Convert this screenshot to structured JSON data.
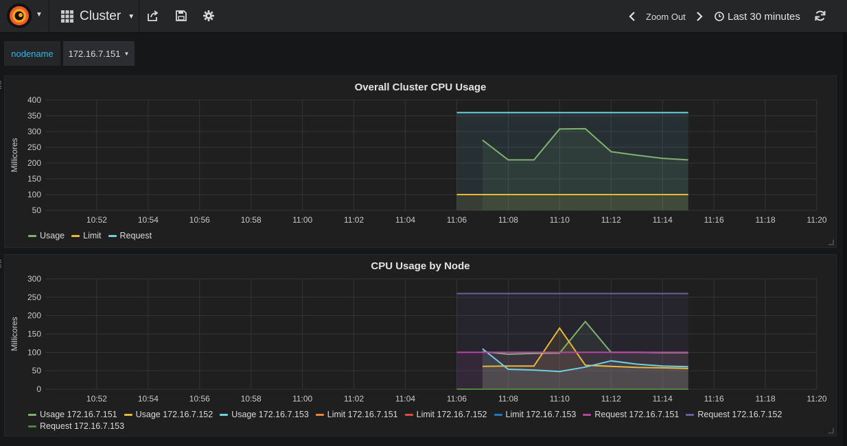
{
  "topbar": {
    "dashboard_title": "Cluster",
    "zoom_out": "Zoom Out",
    "time_range": "Last 30 minutes"
  },
  "variables": {
    "label": "nodename",
    "value": "172.16.7.151"
  },
  "colors": {
    "green": "#7eb26d",
    "yellow": "#eab839",
    "cyan": "#6ed0e0",
    "orange": "#ef843c",
    "red": "#e24d42",
    "blue": "#1f78c1",
    "magenta": "#ba43a9",
    "purple": "#705da0",
    "dark_green": "#508642",
    "accent": "#33b5e5"
  },
  "chart_data": [
    {
      "type": "line",
      "title": "Overall Cluster CPU Usage",
      "ylabel": "Millicores",
      "ylim": [
        50,
        400
      ],
      "yticks": [
        400,
        350,
        300,
        250,
        200,
        150,
        100,
        50
      ],
      "xlim": [
        "10:50",
        "11:20"
      ],
      "xticks": [
        "10:52",
        "10:54",
        "10:56",
        "10:58",
        "11:00",
        "11:02",
        "11:04",
        "11:06",
        "11:08",
        "11:10",
        "11:12",
        "11:14",
        "11:16",
        "11:18",
        "11:20"
      ],
      "grid": true,
      "legend": "bottom-left",
      "series": [
        {
          "name": "Usage",
          "color": "#7eb26d",
          "x": [
            "11:07",
            "11:08",
            "11:09",
            "11:10",
            "11:11",
            "11:12",
            "11:13",
            "11:14",
            "11:15"
          ],
          "values": [
            273,
            210,
            210,
            308,
            309,
            236,
            225,
            215,
            210
          ]
        },
        {
          "name": "Limit",
          "color": "#eab839",
          "x": [
            "11:06",
            "11:15"
          ],
          "values": [
            100,
            100
          ]
        },
        {
          "name": "Request",
          "color": "#6ed0e0",
          "x": [
            "11:06",
            "11:15"
          ],
          "values": [
            360,
            360
          ]
        }
      ]
    },
    {
      "type": "line",
      "title": "CPU Usage by Node",
      "ylabel": "Millicores",
      "ylim": [
        0,
        300
      ],
      "yticks": [
        300,
        250,
        200,
        150,
        100,
        50,
        0
      ],
      "xlim": [
        "10:50",
        "11:20"
      ],
      "xticks": [
        "10:52",
        "10:54",
        "10:56",
        "10:58",
        "11:00",
        "11:02",
        "11:04",
        "11:06",
        "11:08",
        "11:10",
        "11:12",
        "11:14",
        "11:16",
        "11:18",
        "11:20"
      ],
      "grid": true,
      "legend": "bottom-left",
      "series": [
        {
          "name": "Usage 172.16.7.151",
          "color": "#7eb26d",
          "x": [
            "11:07",
            "11:08",
            "11:09",
            "11:10",
            "11:11",
            "11:12",
            "11:13",
            "11:14",
            "11:15"
          ],
          "values": [
            102,
            95,
            97,
            98,
            184,
            100,
            100,
            99,
            99
          ]
        },
        {
          "name": "Usage 172.16.7.152",
          "color": "#eab839",
          "x": [
            "11:07",
            "11:08",
            "11:09",
            "11:10",
            "11:11",
            "11:12",
            "11:13",
            "11:14",
            "11:15"
          ],
          "values": [
            62,
            63,
            63,
            166,
            65,
            62,
            59,
            58,
            56
          ]
        },
        {
          "name": "Usage 172.16.7.153",
          "color": "#6ed0e0",
          "x": [
            "11:07",
            "11:08",
            "11:09",
            "11:10",
            "11:11",
            "11:12",
            "11:13",
            "11:14",
            "11:15"
          ],
          "values": [
            110,
            54,
            52,
            48,
            60,
            77,
            68,
            63,
            61
          ]
        },
        {
          "name": "Limit 172.16.7.151",
          "color": "#ef843c",
          "x": [
            "11:06",
            "11:15"
          ],
          "values": [
            0,
            0
          ]
        },
        {
          "name": "Limit 172.16.7.152",
          "color": "#e24d42",
          "x": [
            "11:06",
            "11:15"
          ],
          "values": [
            0,
            0
          ]
        },
        {
          "name": "Limit 172.16.7.153",
          "color": "#1f78c1",
          "x": [
            "11:06",
            "11:15"
          ],
          "values": [
            0,
            0
          ]
        },
        {
          "name": "Request 172.16.7.151",
          "color": "#ba43a9",
          "x": [
            "11:06",
            "11:15"
          ],
          "values": [
            100,
            100
          ]
        },
        {
          "name": "Request 172.16.7.152",
          "color": "#705da0",
          "x": [
            "11:06",
            "11:15"
          ],
          "values": [
            260,
            260
          ]
        },
        {
          "name": "Request 172.16.7.153",
          "color": "#508642",
          "x": [
            "11:06",
            "11:15"
          ],
          "values": [
            0,
            0
          ]
        }
      ]
    }
  ]
}
